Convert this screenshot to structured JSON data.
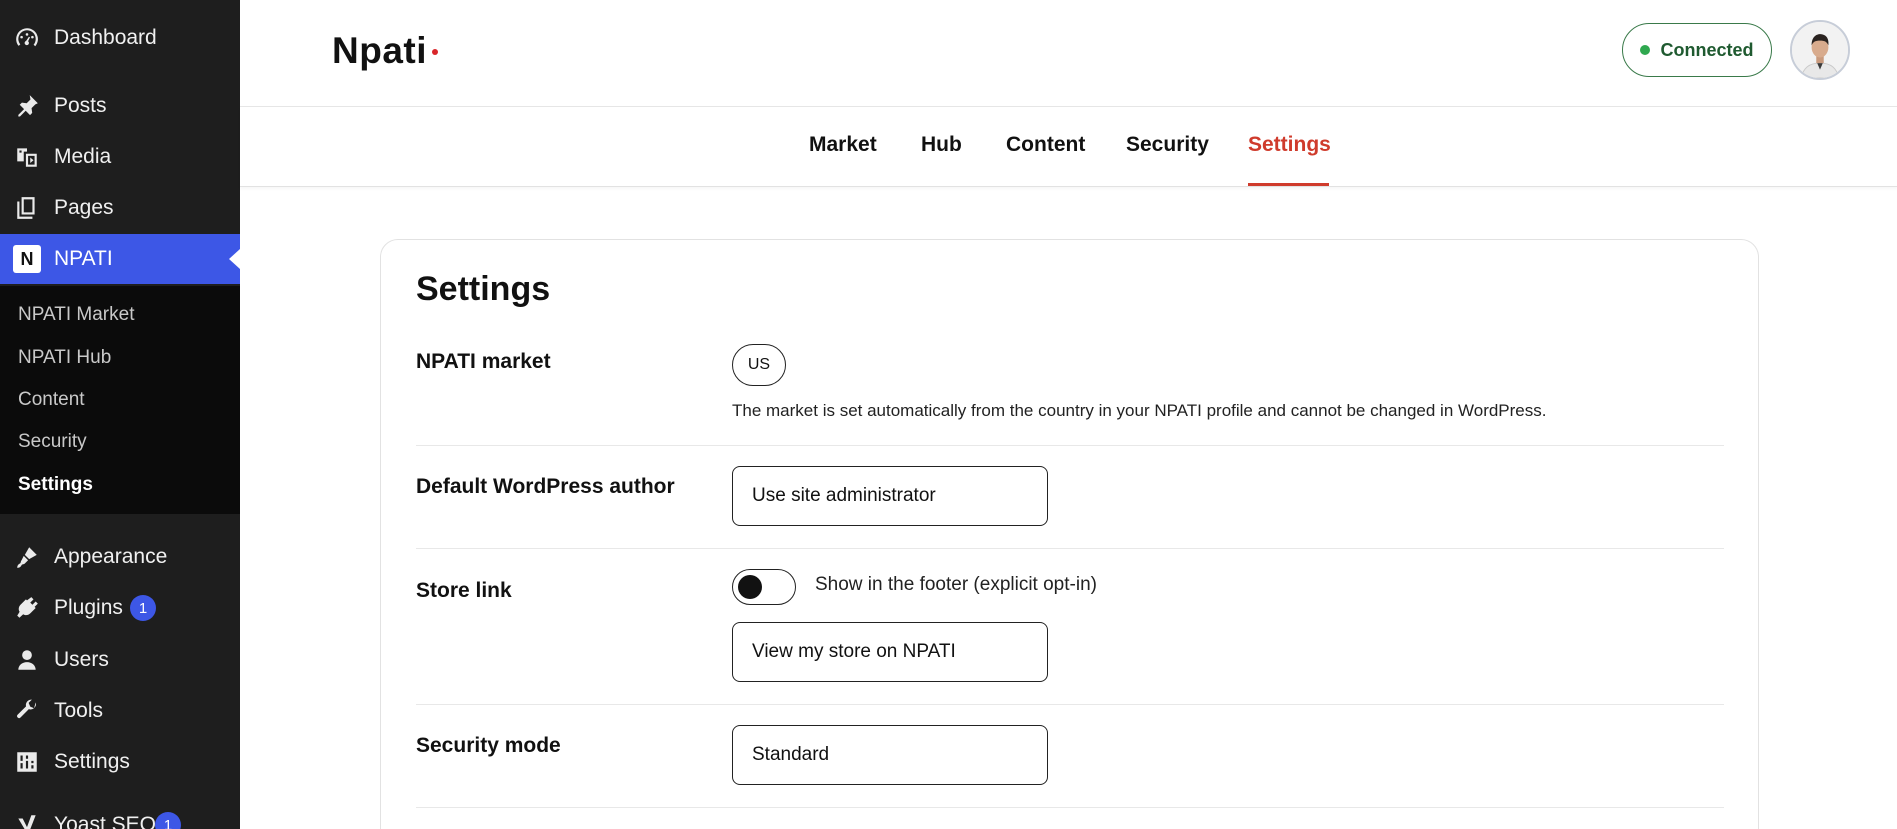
{
  "sidebar": {
    "menu": [
      {
        "label": "Dashboard",
        "icon": "dashboard-icon"
      },
      {
        "label": "Posts",
        "icon": "pin-icon"
      },
      {
        "label": "Media",
        "icon": "media-icon"
      },
      {
        "label": "Pages",
        "icon": "pages-icon"
      },
      {
        "label": "NPATI",
        "icon": "npati-logo-icon",
        "logo_letter": "N"
      },
      {
        "label": "Appearance",
        "icon": "brush-icon"
      },
      {
        "label": "Plugins",
        "icon": "plug-icon",
        "badge": "1"
      },
      {
        "label": "Users",
        "icon": "user-icon"
      },
      {
        "label": "Tools",
        "icon": "wrench-icon"
      },
      {
        "label": "Settings",
        "icon": "sliders-icon"
      },
      {
        "label": "Yoast SEO",
        "icon": "yoast-icon",
        "badge": "1"
      }
    ],
    "submenu": [
      "NPATI Market",
      "NPATI Hub",
      "Content",
      "Security",
      "Settings"
    ],
    "active_color": "#3d57e6"
  },
  "header": {
    "brand": "Npati",
    "brand_dot_color": "#d9262a",
    "status": "Connected",
    "status_color": "#2fa84f"
  },
  "tabs": [
    {
      "label": "Market"
    },
    {
      "label": "Hub"
    },
    {
      "label": "Content"
    },
    {
      "label": "Security"
    },
    {
      "label": "Settings",
      "active": true
    }
  ],
  "settings": {
    "title": "Settings",
    "market": {
      "label": "NPATI market",
      "value": "US",
      "help": "The market is set automatically from the country in your NPATI profile and cannot be changed in WordPress."
    },
    "author": {
      "label": "Default WordPress author",
      "value": "Use site administrator"
    },
    "store_link": {
      "label": "Store link",
      "toggle_label": "Show in the footer (explicit opt-in)",
      "toggle_on": false,
      "link_text": "View my store on NPATI"
    },
    "security_mode": {
      "label": "Security mode",
      "value": "Standard"
    }
  },
  "accent_color": "#cf3b2c"
}
